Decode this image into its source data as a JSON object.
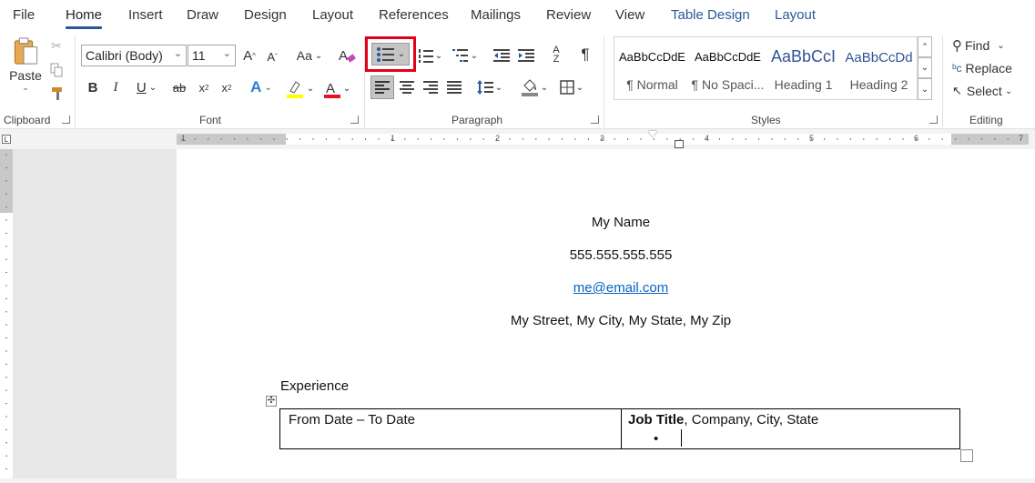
{
  "menu": {
    "tabs": [
      "File",
      "Home",
      "Insert",
      "Draw",
      "Design",
      "Layout",
      "References",
      "Mailings",
      "Review",
      "View",
      "Table Design",
      "Layout"
    ],
    "active": "Home"
  },
  "ribbon": {
    "clipboard": {
      "paste_label": "Paste",
      "group_label": "Clipboard"
    },
    "font": {
      "font_name": "Calibri (Body)",
      "font_size": "11",
      "group_label": "Font",
      "change_case": "Aa"
    },
    "paragraph": {
      "group_label": "Paragraph"
    },
    "styles": {
      "group_label": "Styles",
      "items": [
        {
          "sample": "AaBbCcDdE",
          "name": "¶ Normal"
        },
        {
          "sample": "AaBbCcDdE",
          "name": "¶ No Spaci..."
        },
        {
          "sample": "AaBbCcI",
          "name": "Heading 1"
        },
        {
          "sample": "AaBbCcDd",
          "name": "Heading 2"
        }
      ]
    },
    "editing": {
      "group_label": "Editing",
      "find": "Find",
      "replace": "Replace",
      "select": "Select"
    }
  },
  "ruler": {
    "numbers": [
      "1",
      "1",
      "2",
      "3",
      "4",
      "5",
      "6",
      "7"
    ]
  },
  "document": {
    "name": "My Name",
    "phone": "555.555.555.555",
    "email": "me@email.com",
    "address": "My Street, My City, My State, My Zip",
    "section_heading": "Experience",
    "table": {
      "dates": "From Date – To Date",
      "job_title": "Job Title",
      "job_rest": ", Company, City, State",
      "bullet": "•"
    }
  },
  "colors": {
    "accent": "#2b579a",
    "highlight_box": "#e3001b",
    "link": "#0563c1"
  }
}
